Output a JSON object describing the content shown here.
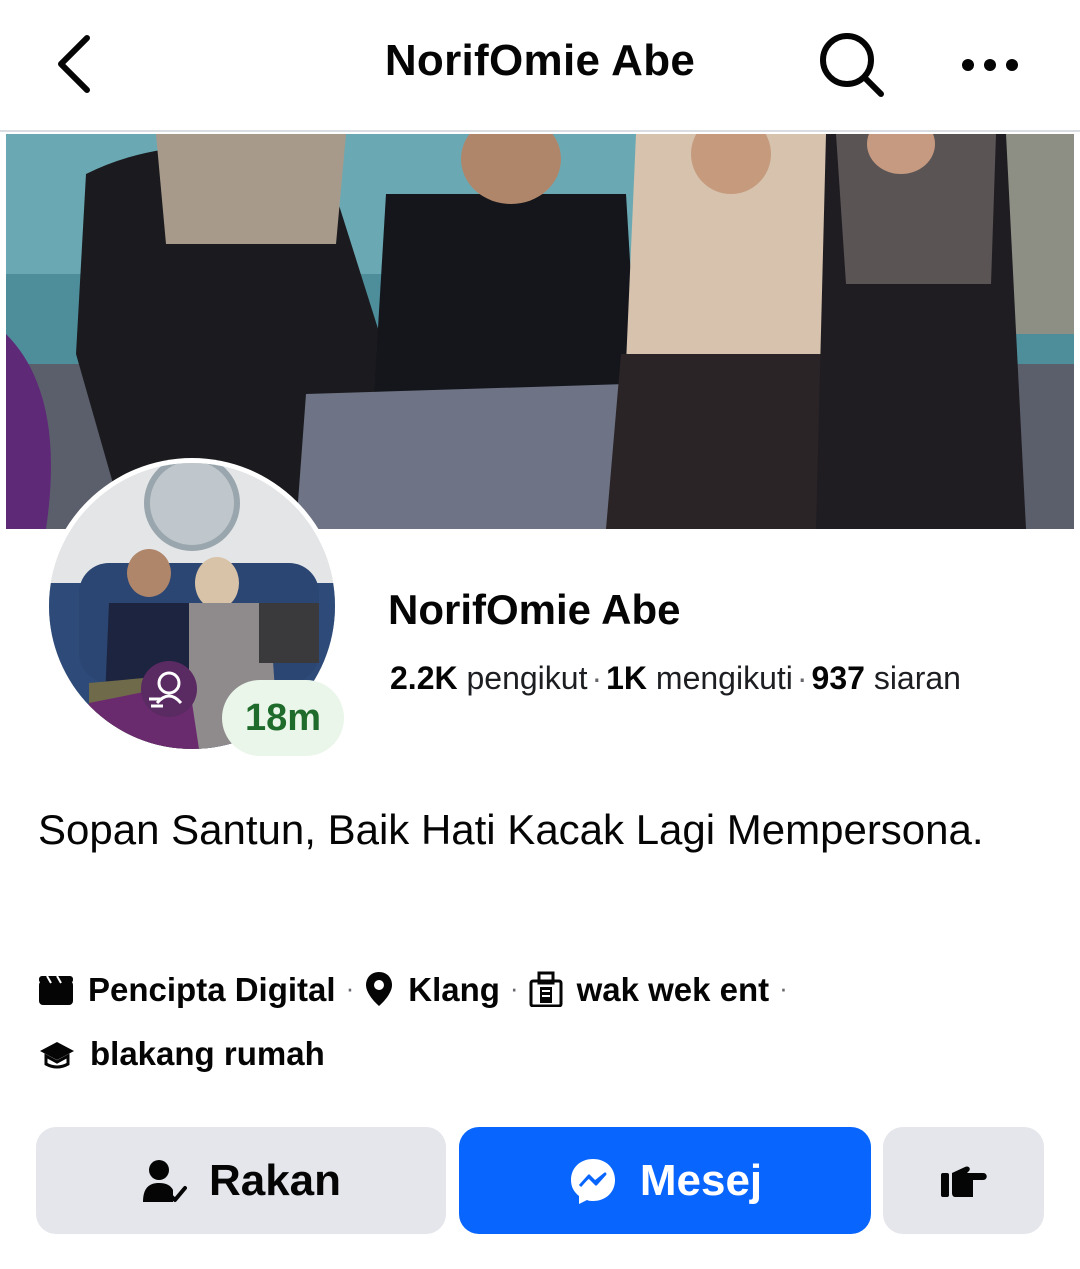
{
  "header": {
    "title": "NorifOmie Abe",
    "back_icon": "chevron-left-icon",
    "search_icon": "search-icon",
    "more_icon": "more-horizontal-icon"
  },
  "profile": {
    "name": "NorifOmie Abe",
    "badge": "18m",
    "stats": {
      "followers_value": "2.2K",
      "followers_label": "pengikut",
      "following_value": "1K",
      "following_label": "mengikuti",
      "posts_value": "937",
      "posts_label": "siaran"
    },
    "bio": "Sopan Santun, Baik Hati Kacak Lagi Mempersona."
  },
  "details": [
    {
      "icon": "clapperboard-icon",
      "text": "Pencipta Digital"
    },
    {
      "icon": "location-pin-icon",
      "text": "Klang"
    },
    {
      "icon": "building-icon",
      "text": "wak wek ent"
    },
    {
      "icon": "graduation-cap-icon",
      "text": "blakang rumah"
    }
  ],
  "actions": {
    "friends_label": "Rakan",
    "message_label": "Mesej",
    "friends_icon": "friend-check-icon",
    "message_icon": "messenger-icon",
    "poke_icon": "poke-hand-icon"
  },
  "colors": {
    "primary": "#0866ff",
    "secondary_button": "#e4e6eb",
    "badge_bg": "#eaf6e9",
    "badge_text": "#1f6b2c"
  }
}
